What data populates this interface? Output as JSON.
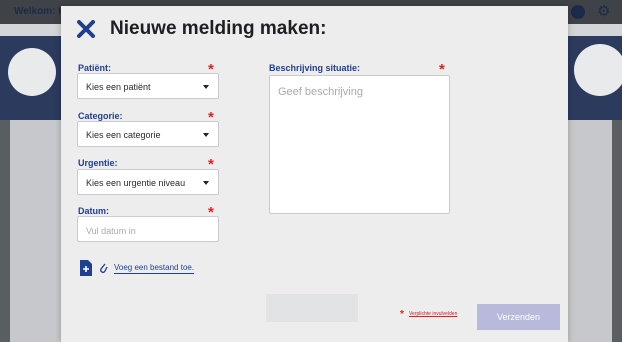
{
  "background": {
    "welcome_text": "Welkom: K",
    "user_icon": "user-icon",
    "settings_icon": "gear-icon"
  },
  "modal": {
    "title": "Nieuwe melding maken:",
    "close_icon": "close-icon",
    "fields": {
      "patient": {
        "label": "Patiënt:",
        "value": "Kies een patiënt"
      },
      "category": {
        "label": "Categorie:",
        "value": "Kies een categorie"
      },
      "urgency": {
        "label": "Urgentie:",
        "value": "Kies een urgentie niveau"
      },
      "date": {
        "label": "Datum:",
        "placeholder": "Vul datum in"
      },
      "description": {
        "label": "Beschrijving situatie:",
        "placeholder": "Geef beschrijving"
      }
    },
    "required_marker": "*",
    "attach": {
      "icon": "file-add-icon",
      "clip_icon": "paperclip-icon",
      "label": "Voeg een bestand toe."
    },
    "required_note": "Verplichte invulvelden",
    "send_label": "Verzenden"
  },
  "colors": {
    "accent": "#1f3f8f",
    "required": "#e0201c",
    "send_disabled": "#b8badc"
  }
}
